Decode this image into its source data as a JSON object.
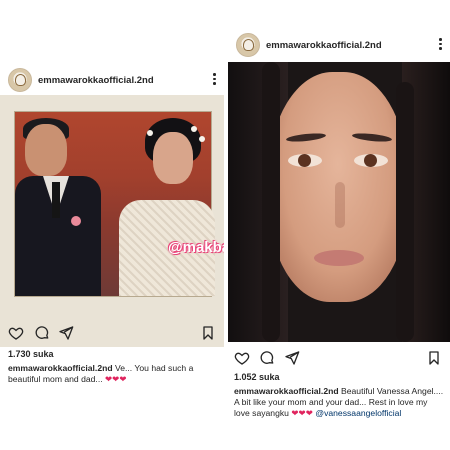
{
  "left_post": {
    "username": "emmawarokkaofficial.2nd",
    "watermark": "@makbacot",
    "likes": "1.730 suka",
    "caption_user": "emmawarokkaofficial.2nd",
    "caption_text": "Ve... You had such a beautiful mom and dad...",
    "caption_emoji": "❤❤❤"
  },
  "right_post": {
    "username": "emmawarokkaofficial.2nd",
    "likes": "1.052 suka",
    "caption_user": "emmawarokkaofficial.2nd",
    "caption_text": "Beautiful Vanessa Angel.... A bit like your mom and your dad... Rest in love my love sayangku",
    "caption_emoji": "❤❤❤",
    "caption_mention": "@vanessaangelofficial"
  },
  "icons": [
    "avatar-logo",
    "more-options-icon",
    "heart-icon",
    "comment-icon",
    "share-icon",
    "bookmark-icon"
  ],
  "colors": {
    "heart": "#e0245e",
    "mention": "#003569",
    "text": "#262626"
  }
}
